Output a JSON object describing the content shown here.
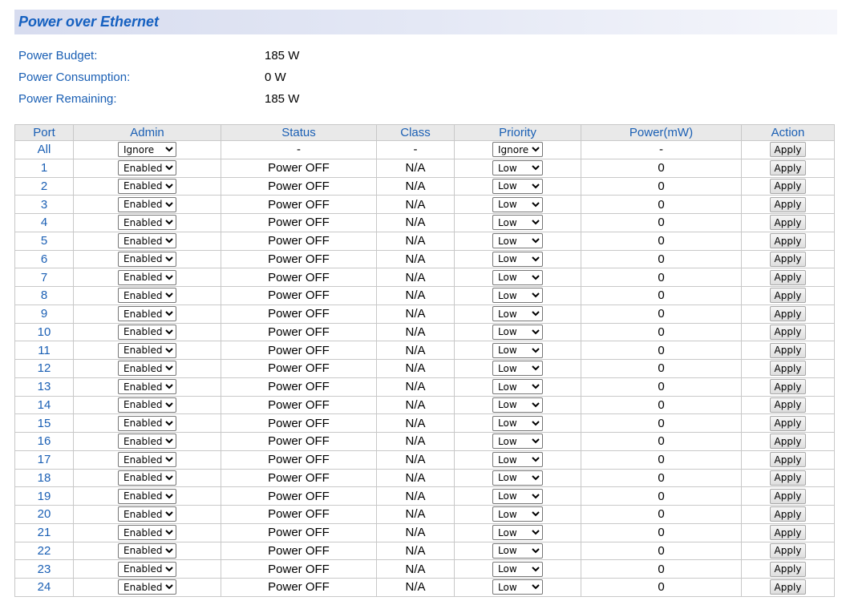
{
  "title": "Power over Ethernet",
  "summary": [
    {
      "label": "Power Budget:",
      "value": "185 W"
    },
    {
      "label": "Power Consumption:",
      "value": "0 W"
    },
    {
      "label": "Power Remaining:",
      "value": "185 W"
    }
  ],
  "columns": [
    "Port",
    "Admin",
    "Status",
    "Class",
    "Priority",
    "Power(mW)",
    "Action"
  ],
  "apply_label": "Apply",
  "rows": [
    {
      "port": "All",
      "admin": "Ignore",
      "status": "-",
      "class": "-",
      "priority": "Ignore",
      "power": "-"
    },
    {
      "port": "1",
      "admin": "Enabled",
      "status": "Power OFF",
      "class": "N/A",
      "priority": "Low",
      "power": "0"
    },
    {
      "port": "2",
      "admin": "Enabled",
      "status": "Power OFF",
      "class": "N/A",
      "priority": "Low",
      "power": "0"
    },
    {
      "port": "3",
      "admin": "Enabled",
      "status": "Power OFF",
      "class": "N/A",
      "priority": "Low",
      "power": "0"
    },
    {
      "port": "4",
      "admin": "Enabled",
      "status": "Power OFF",
      "class": "N/A",
      "priority": "Low",
      "power": "0"
    },
    {
      "port": "5",
      "admin": "Enabled",
      "status": "Power OFF",
      "class": "N/A",
      "priority": "Low",
      "power": "0"
    },
    {
      "port": "6",
      "admin": "Enabled",
      "status": "Power OFF",
      "class": "N/A",
      "priority": "Low",
      "power": "0"
    },
    {
      "port": "7",
      "admin": "Enabled",
      "status": "Power OFF",
      "class": "N/A",
      "priority": "Low",
      "power": "0"
    },
    {
      "port": "8",
      "admin": "Enabled",
      "status": "Power OFF",
      "class": "N/A",
      "priority": "Low",
      "power": "0"
    },
    {
      "port": "9",
      "admin": "Enabled",
      "status": "Power OFF",
      "class": "N/A",
      "priority": "Low",
      "power": "0"
    },
    {
      "port": "10",
      "admin": "Enabled",
      "status": "Power OFF",
      "class": "N/A",
      "priority": "Low",
      "power": "0"
    },
    {
      "port": "11",
      "admin": "Enabled",
      "status": "Power OFF",
      "class": "N/A",
      "priority": "Low",
      "power": "0"
    },
    {
      "port": "12",
      "admin": "Enabled",
      "status": "Power OFF",
      "class": "N/A",
      "priority": "Low",
      "power": "0"
    },
    {
      "port": "13",
      "admin": "Enabled",
      "status": "Power OFF",
      "class": "N/A",
      "priority": "Low",
      "power": "0"
    },
    {
      "port": "14",
      "admin": "Enabled",
      "status": "Power OFF",
      "class": "N/A",
      "priority": "Low",
      "power": "0"
    },
    {
      "port": "15",
      "admin": "Enabled",
      "status": "Power OFF",
      "class": "N/A",
      "priority": "Low",
      "power": "0"
    },
    {
      "port": "16",
      "admin": "Enabled",
      "status": "Power OFF",
      "class": "N/A",
      "priority": "Low",
      "power": "0"
    },
    {
      "port": "17",
      "admin": "Enabled",
      "status": "Power OFF",
      "class": "N/A",
      "priority": "Low",
      "power": "0"
    },
    {
      "port": "18",
      "admin": "Enabled",
      "status": "Power OFF",
      "class": "N/A",
      "priority": "Low",
      "power": "0"
    },
    {
      "port": "19",
      "admin": "Enabled",
      "status": "Power OFF",
      "class": "N/A",
      "priority": "Low",
      "power": "0"
    },
    {
      "port": "20",
      "admin": "Enabled",
      "status": "Power OFF",
      "class": "N/A",
      "priority": "Low",
      "power": "0"
    },
    {
      "port": "21",
      "admin": "Enabled",
      "status": "Power OFF",
      "class": "N/A",
      "priority": "Low",
      "power": "0"
    },
    {
      "port": "22",
      "admin": "Enabled",
      "status": "Power OFF",
      "class": "N/A",
      "priority": "Low",
      "power": "0"
    },
    {
      "port": "23",
      "admin": "Enabled",
      "status": "Power OFF",
      "class": "N/A",
      "priority": "Low",
      "power": "0"
    },
    {
      "port": "24",
      "admin": "Enabled",
      "status": "Power OFF",
      "class": "N/A",
      "priority": "Low",
      "power": "0"
    }
  ],
  "colors": {
    "title": "#1560c0",
    "label": "#1a5fb4",
    "header_bg": "#e9e9e9",
    "border": "#c8c8c8"
  }
}
